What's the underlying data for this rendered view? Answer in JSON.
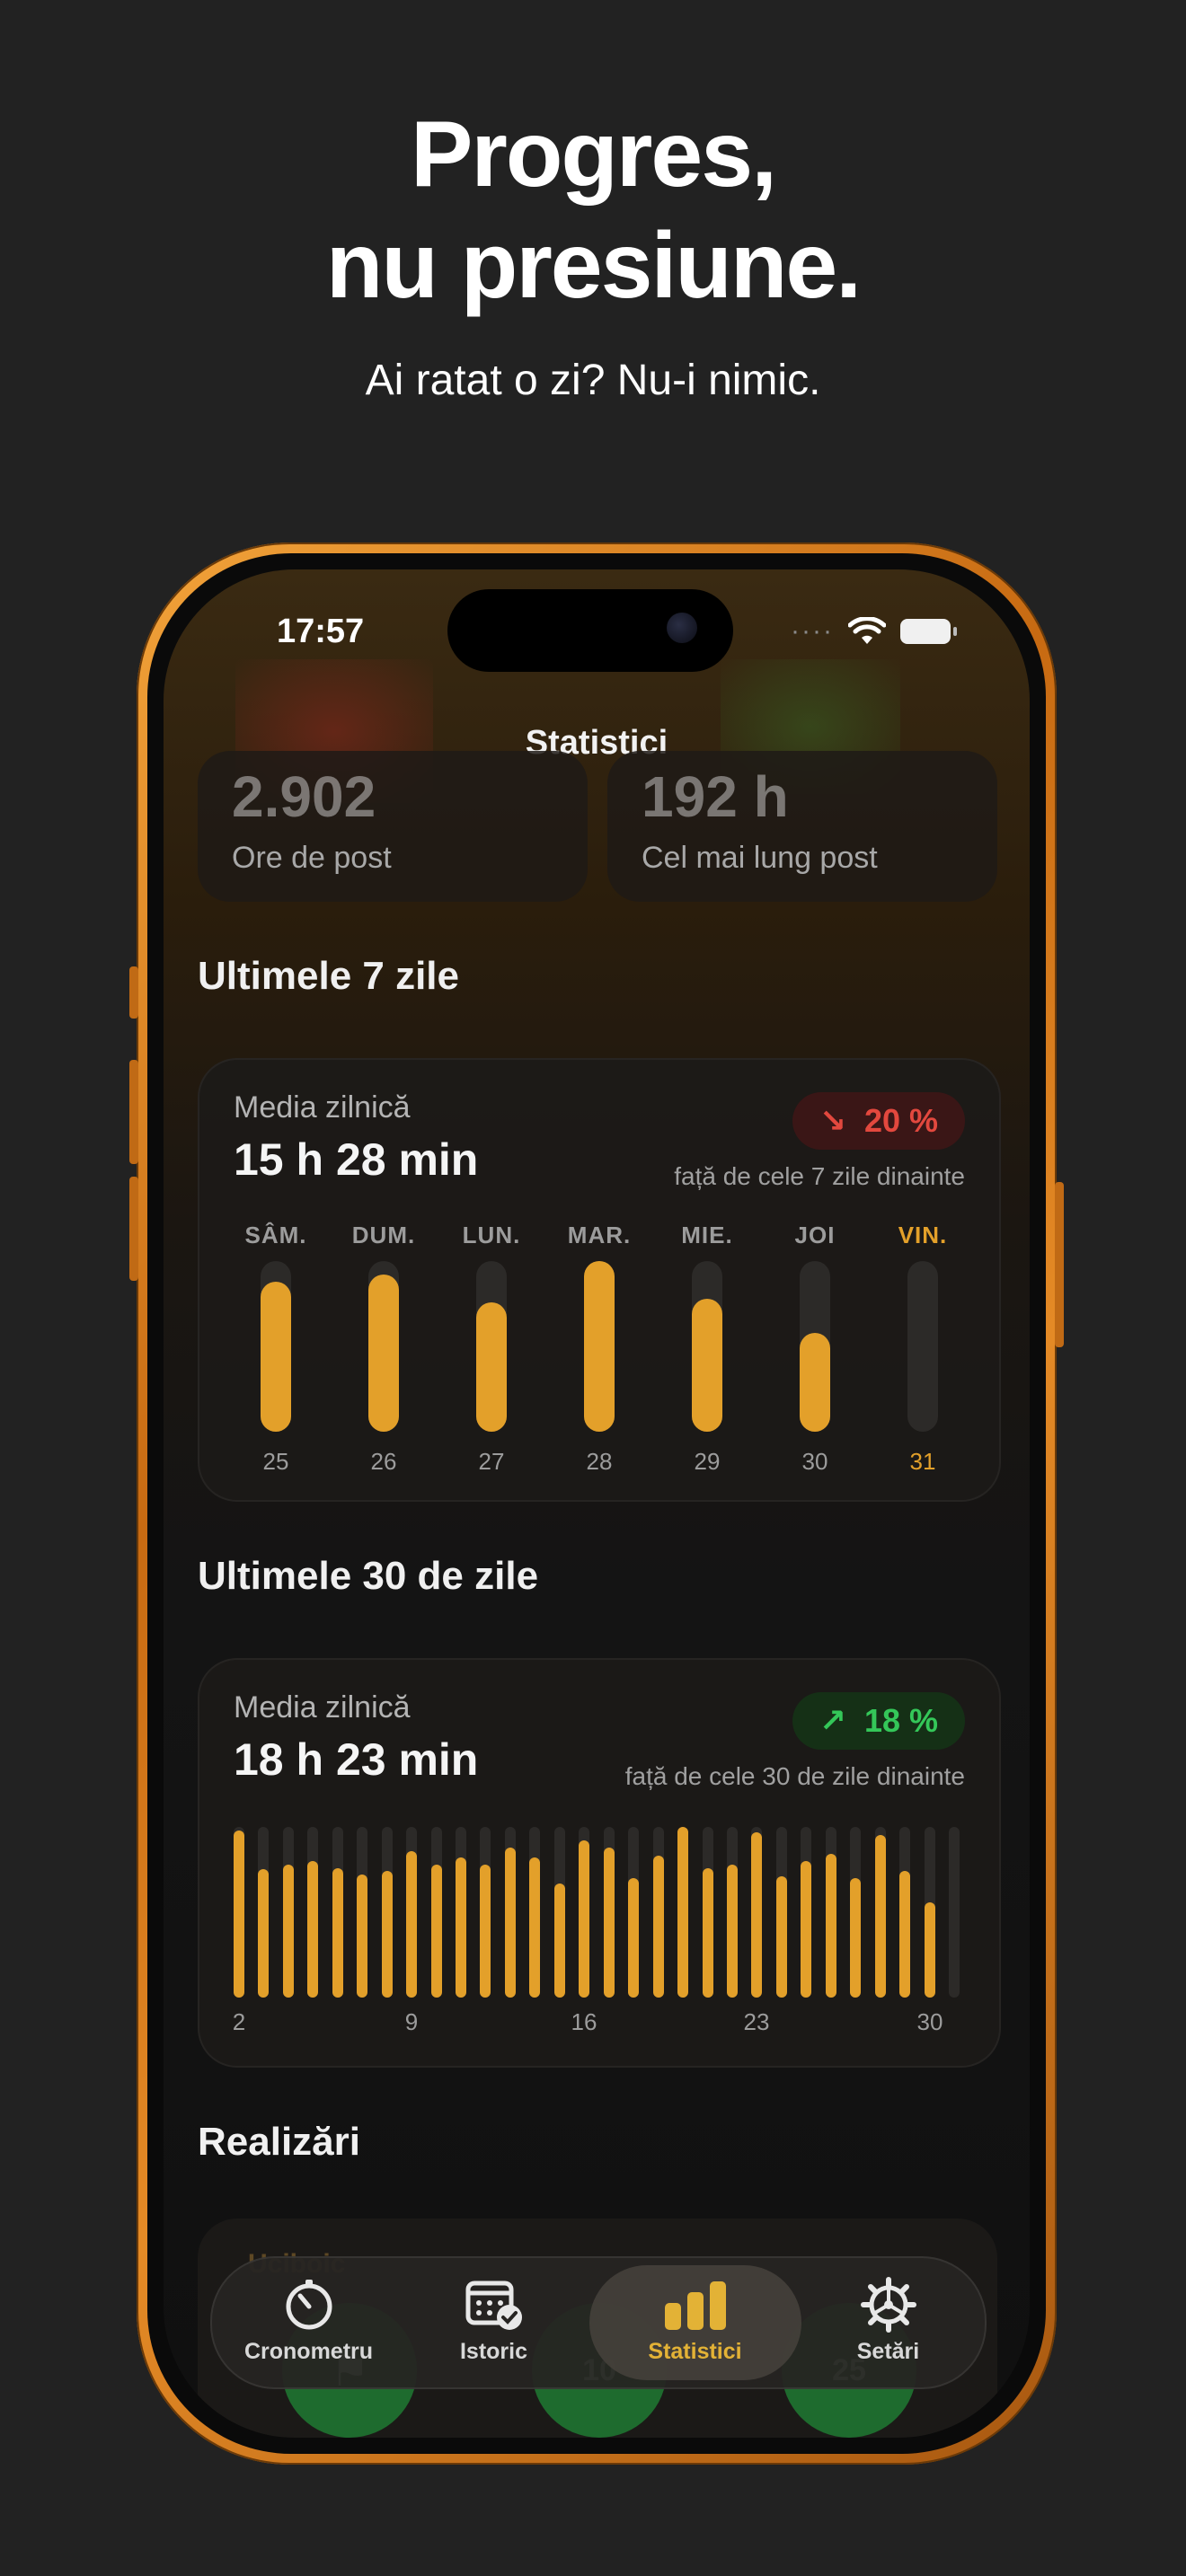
{
  "hero": {
    "title_line1": "Progres,",
    "title_line2": "nu presiune.",
    "subtitle": "Ai ratat o zi? Nu-i nimic."
  },
  "status_bar": {
    "time": "17:57",
    "signal": "····"
  },
  "screen_title": "Statistici",
  "stats": [
    {
      "value": "2.902",
      "label": "Ore de post"
    },
    {
      "value": "192 h",
      "label": "Cel mai lung post"
    }
  ],
  "week": {
    "section_title": "Ultimele 7 zile",
    "card_label": "Media zilnică",
    "average": "15 h 28 min",
    "trend": {
      "direction": "down",
      "arrow": "↘",
      "value": "20 %",
      "compare": "față de cele 7 zile dinainte",
      "color": "#e2483e"
    },
    "days": [
      {
        "name": "SÂM.",
        "num": "25",
        "fraction": 0.88
      },
      {
        "name": "DUM.",
        "num": "26",
        "fraction": 0.92
      },
      {
        "name": "LUN.",
        "num": "27",
        "fraction": 0.76
      },
      {
        "name": "MAR.",
        "num": "28",
        "fraction": 1.0
      },
      {
        "name": "MIE.",
        "num": "29",
        "fraction": 0.78
      },
      {
        "name": "JOI",
        "num": "30",
        "fraction": 0.58
      },
      {
        "name": "VIN.",
        "num": "31",
        "fraction": 0.0,
        "today": true
      }
    ]
  },
  "month": {
    "section_title": "Ultimele 30 de zile",
    "card_label": "Media zilnică",
    "average": "18 h 23 min",
    "trend": {
      "direction": "up",
      "arrow": "↗",
      "value": "18 %",
      "compare": "față de cele 30 de zile dinainte",
      "color": "#34c759"
    },
    "tick_labels": [
      "2",
      "9",
      "16",
      "23",
      "30"
    ],
    "bar_fractions": [
      0.98,
      0.75,
      0.78,
      0.8,
      0.76,
      0.72,
      0.74,
      0.86,
      0.78,
      0.82,
      0.78,
      0.88,
      0.82,
      0.67,
      0.92,
      0.88,
      0.7,
      0.83,
      1.0,
      0.76,
      0.78,
      0.97,
      0.71,
      0.8,
      0.84,
      0.7,
      0.95,
      0.74,
      0.56,
      0.0
    ]
  },
  "achievements": {
    "section_title": "Realizări",
    "partial_text": "Uciboic",
    "medals": [
      "",
      "10",
      "25"
    ]
  },
  "tabbar": {
    "tabs": [
      {
        "label": "Cronometru",
        "icon": "timer-icon"
      },
      {
        "label": "Istoric",
        "icon": "calendar-check-icon"
      },
      {
        "label": "Statistici",
        "icon": "chart-bars-icon",
        "active": true
      },
      {
        "label": "Setări",
        "icon": "gear-icon"
      }
    ]
  },
  "colors": {
    "accent": "#e3a02a",
    "track": "#2c2a28",
    "frame": "#e48a26"
  }
}
